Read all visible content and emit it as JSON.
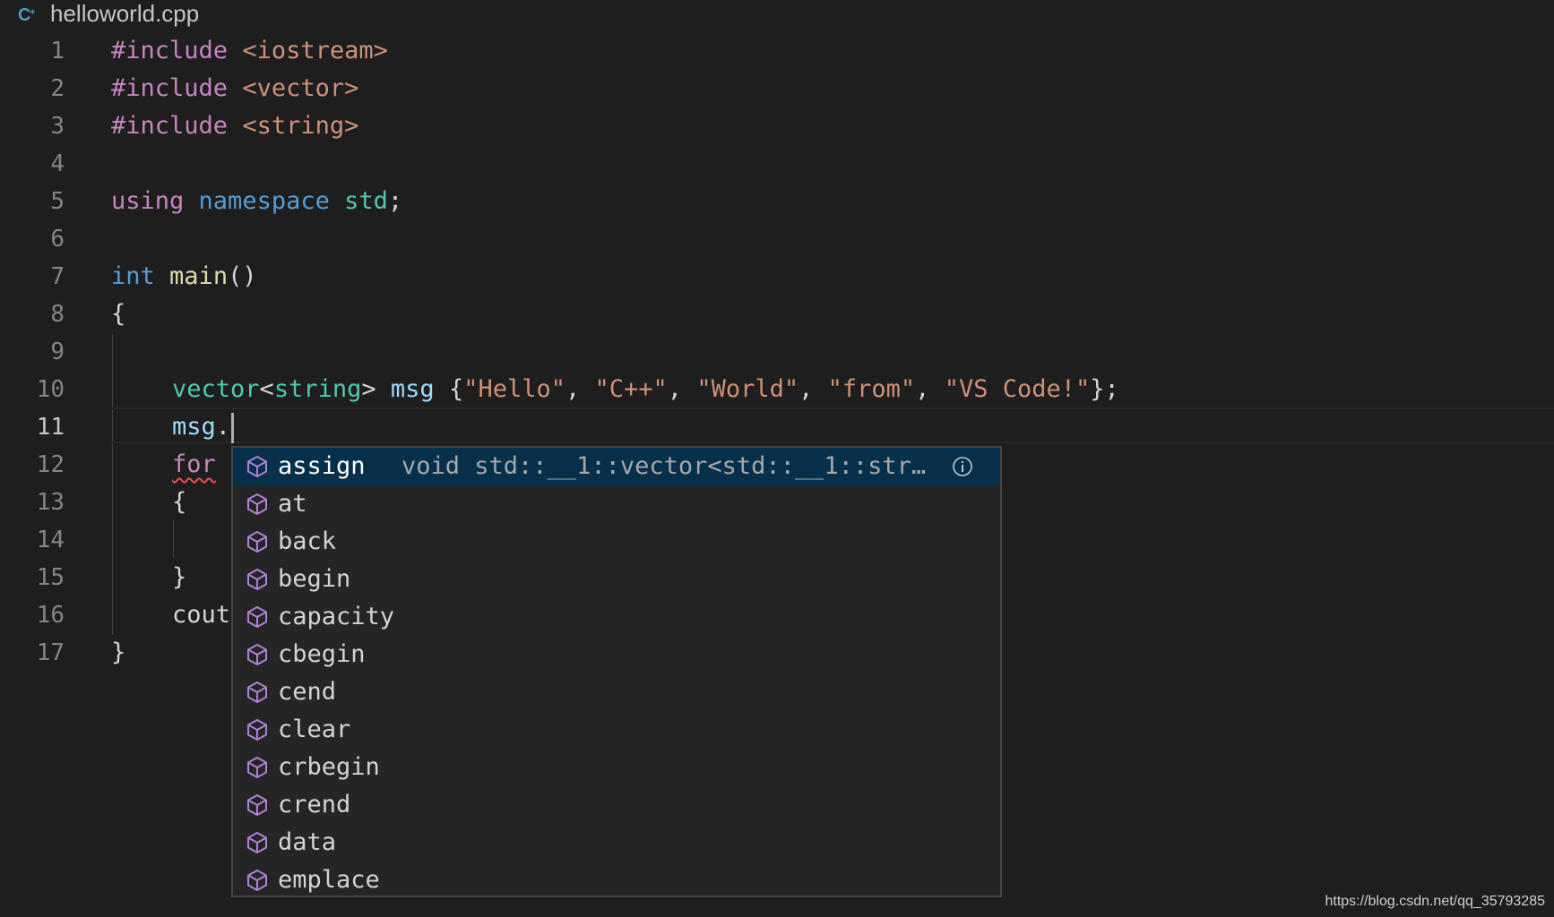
{
  "tab": {
    "icon": "cpp-file-icon",
    "icon_text": "C+",
    "file_name": "helloworld.cpp"
  },
  "colors": {
    "background": "#1e1e1e",
    "preprocessor": "#c586c0",
    "include_path": "#ce9178",
    "keyword": "#569cd6",
    "type": "#4ec9b0",
    "function": "#dcdcaa",
    "variable": "#9cdcfe",
    "string": "#ce9178",
    "suggest_selected": "#062f4a",
    "method_icon": "#b180d7"
  },
  "editor": {
    "active_line": 11,
    "lines": [
      {
        "num": "1"
      },
      {
        "num": "2"
      },
      {
        "num": "3"
      },
      {
        "num": "4"
      },
      {
        "num": "5"
      },
      {
        "num": "6"
      },
      {
        "num": "7"
      },
      {
        "num": "8"
      },
      {
        "num": "9"
      },
      {
        "num": "10"
      },
      {
        "num": "11"
      },
      {
        "num": "12"
      },
      {
        "num": "13"
      },
      {
        "num": "14"
      },
      {
        "num": "15"
      },
      {
        "num": "16"
      },
      {
        "num": "17"
      }
    ],
    "code": {
      "l1": {
        "directive": "#include",
        "path": "<iostream>"
      },
      "l2": {
        "directive": "#include",
        "path": "<vector>"
      },
      "l3": {
        "directive": "#include",
        "path": "<string>"
      },
      "l5": {
        "using": "using",
        "namespace": "namespace",
        "std": "std",
        "semi": ";"
      },
      "l7": {
        "type": "int",
        "fn": "main",
        "parens": "()"
      },
      "l8": {
        "brace": "{"
      },
      "l10": {
        "vector": "vector",
        "lt": "<",
        "string": "string",
        "gt": ">",
        "msg": "msg",
        "open": "{",
        "s1": "\"Hello\"",
        "s2": "\"C++\"",
        "s3": "\"World\"",
        "s4": "\"from\"",
        "s5": "\"VS Code!\"",
        "comma": ", ",
        "close": "};"
      },
      "l11": {
        "msg": "msg",
        "dot": "."
      },
      "l12": {
        "for": "for"
      },
      "l13": {
        "brace": "{"
      },
      "l15": {
        "brace": "}"
      },
      "l16": {
        "cout": "cout"
      },
      "l17": {
        "brace": "}"
      }
    }
  },
  "suggest": {
    "selected_index": 0,
    "selected_detail": "void std::__1::vector<std::__1::str…",
    "info_icon": "info-icon",
    "item_icon": "method-cube-icon",
    "items": [
      {
        "label": "assign"
      },
      {
        "label": "at"
      },
      {
        "label": "back"
      },
      {
        "label": "begin"
      },
      {
        "label": "capacity"
      },
      {
        "label": "cbegin"
      },
      {
        "label": "cend"
      },
      {
        "label": "clear"
      },
      {
        "label": "crbegin"
      },
      {
        "label": "crend"
      },
      {
        "label": "data"
      },
      {
        "label": "emplace"
      }
    ]
  },
  "watermark": "https://blog.csdn.net/qq_35793285"
}
